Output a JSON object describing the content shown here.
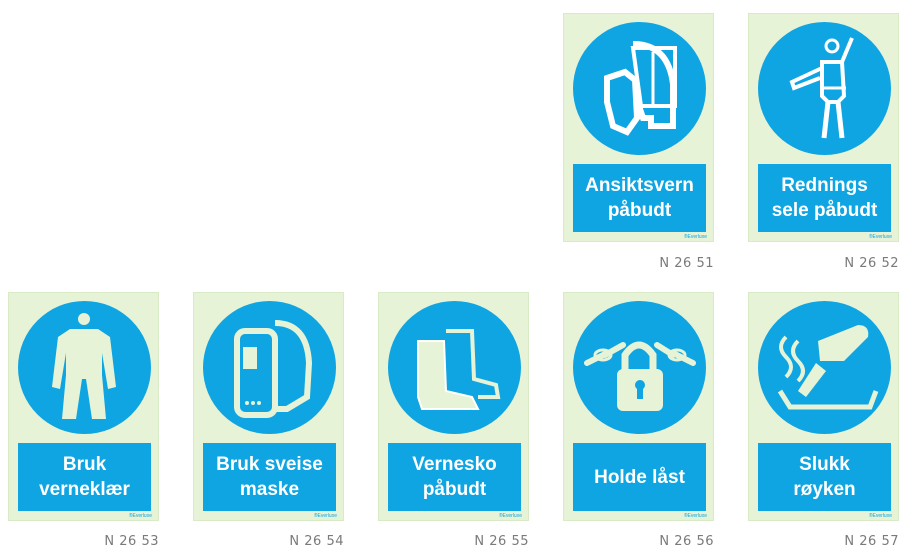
{
  "signs": [
    {
      "label": "Ansiktsvern\npåbudt",
      "code": "N 26 51",
      "icon": "face-shield-icon",
      "brand": "®Everluxe"
    },
    {
      "label": "Rednings\nsele påbudt",
      "code": "N 26 52",
      "icon": "safety-harness-icon",
      "brand": "®Everluxe"
    },
    {
      "label": "Bruk\nverneklær",
      "code": "N 26 53",
      "icon": "coverall-icon",
      "brand": "®Everluxe"
    },
    {
      "label": "Bruk sveise\nmaske",
      "code": "N 26 54",
      "icon": "welding-mask-icon",
      "brand": "®Everluxe"
    },
    {
      "label": "Vernesko\npåbudt",
      "code": "N 26 55",
      "icon": "safety-boots-icon",
      "brand": "®Everluxe"
    },
    {
      "label": "Holde låst",
      "code": "N 26 56",
      "icon": "padlock-chain-icon",
      "brand": "®Everluxe"
    },
    {
      "label": "Slukk\nrøyken",
      "code": "N 26 57",
      "icon": "extinguish-cigarette-icon",
      "brand": "®Everluxe"
    }
  ],
  "colors": {
    "sign_blue": "#0fa5e2",
    "glow_bg": "#e6f3d7",
    "code_gray": "#7a7a7a"
  }
}
